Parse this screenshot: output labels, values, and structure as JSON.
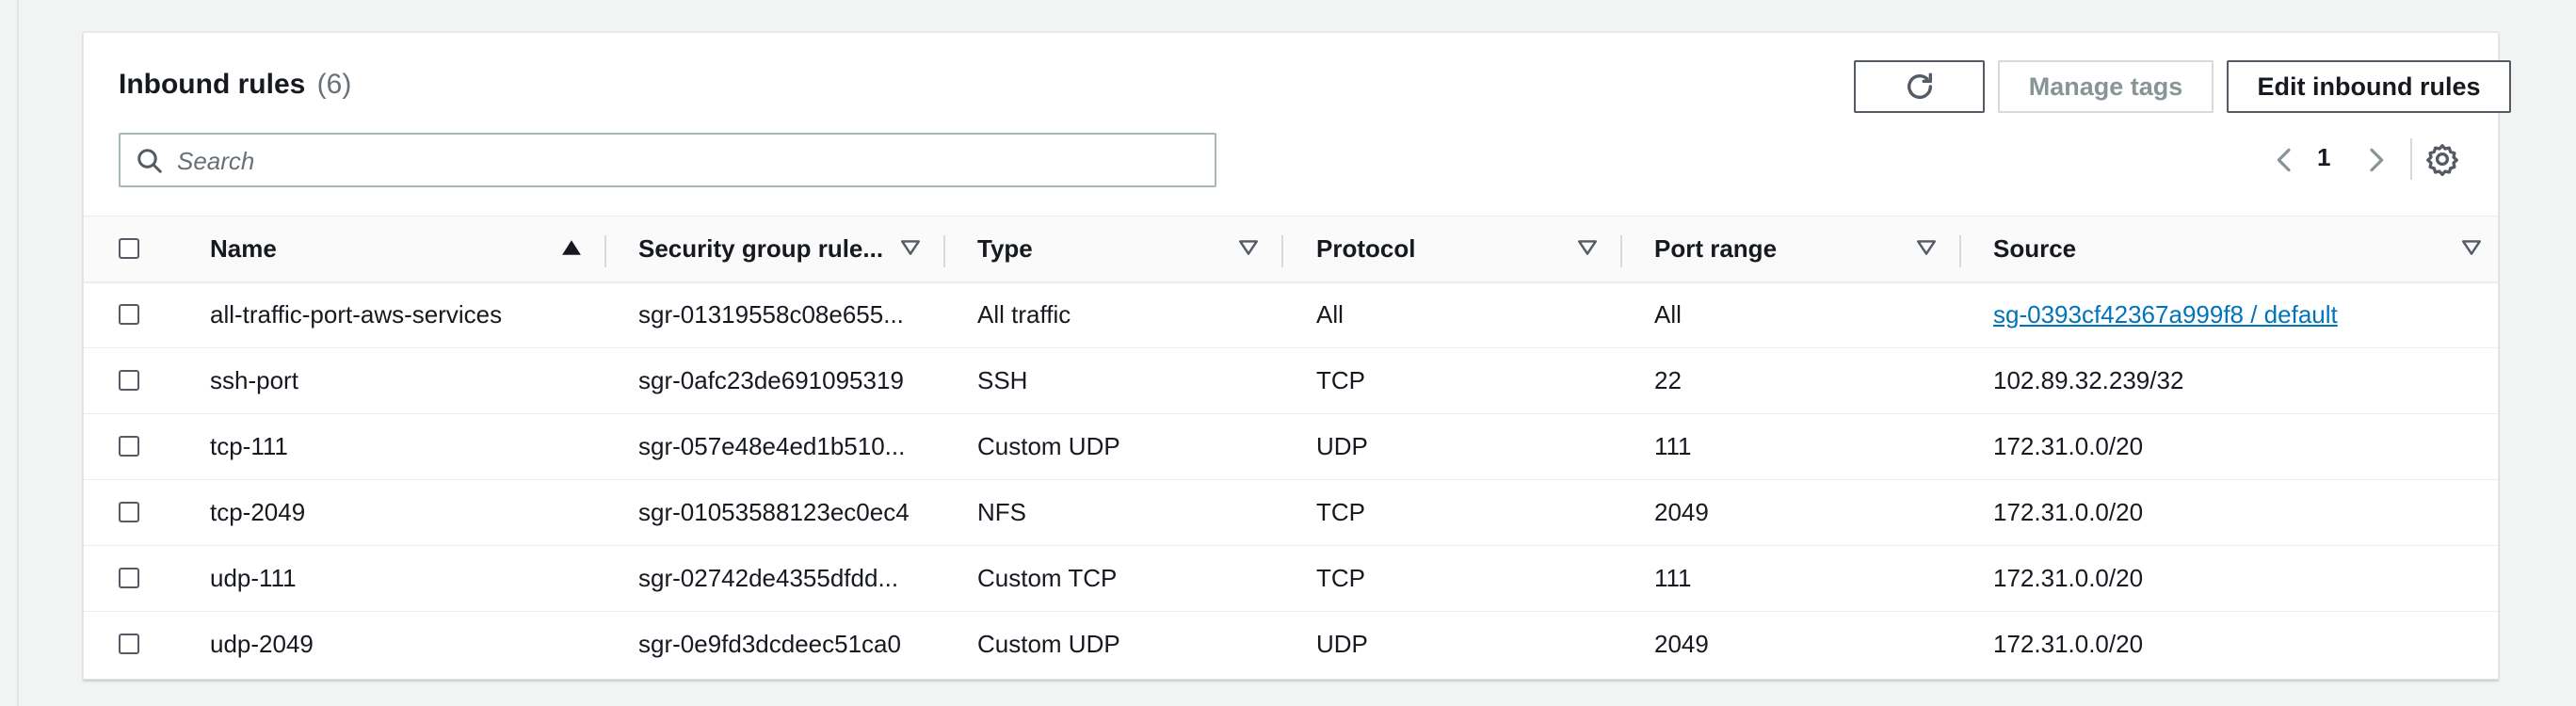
{
  "header": {
    "title": "Inbound rules",
    "count": "(6)",
    "manage_tags_label": "Manage tags",
    "edit_label": "Edit inbound rules"
  },
  "search": {
    "placeholder": "Search",
    "value": ""
  },
  "pagination": {
    "current_page": "1"
  },
  "icons": {
    "refresh": "refresh-icon",
    "search": "search-icon",
    "prev": "chevron-left-icon",
    "next": "chevron-right-icon",
    "settings": "gear-icon",
    "sort_asc": "sort-ascending-icon",
    "sort": "sort-caret-icon"
  },
  "colors": {
    "link": "#0073bb",
    "text": "#16191f",
    "muted": "#687078",
    "disabled": "#879596"
  },
  "table": {
    "columns": [
      "Name",
      "Security group rule...",
      "Type",
      "Protocol",
      "Port range",
      "Source"
    ],
    "rows": [
      {
        "name": "all-traffic-port-aws-services",
        "rule_id": "sgr-01319558c08e655...",
        "type": "All traffic",
        "protocol": "All",
        "port_range": "All",
        "source": "sg-0393cf42367a999f8 / default"
      },
      {
        "name": "ssh-port",
        "rule_id": "sgr-0afc23de691095319",
        "type": "SSH",
        "protocol": "TCP",
        "port_range": "22",
        "source": "102.89.32.239/32"
      },
      {
        "name": "tcp-111",
        "rule_id": "sgr-057e48e4ed1b510...",
        "type": "Custom UDP",
        "protocol": "UDP",
        "port_range": "111",
        "source": "172.31.0.0/20"
      },
      {
        "name": "tcp-2049",
        "rule_id": "sgr-01053588123ec0ec4",
        "type": "NFS",
        "protocol": "TCP",
        "port_range": "2049",
        "source": "172.31.0.0/20"
      },
      {
        "name": "udp-111",
        "rule_id": "sgr-02742de4355dfdd...",
        "type": "Custom TCP",
        "protocol": "TCP",
        "port_range": "111",
        "source": "172.31.0.0/20"
      },
      {
        "name": "udp-2049",
        "rule_id": "sgr-0e9fd3dcdeec51ca0",
        "type": "Custom UDP",
        "protocol": "UDP",
        "port_range": "2049",
        "source": "172.31.0.0/20"
      }
    ]
  }
}
